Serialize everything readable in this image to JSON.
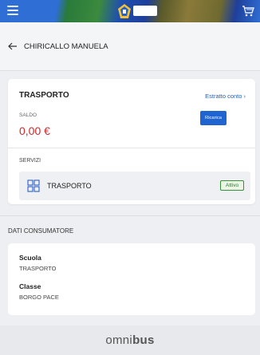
{
  "topbar": {
    "menu_icon": "hamburger-menu-icon",
    "logo_icon": "coat-of-arms-icon",
    "cart_icon": "cart-icon"
  },
  "header": {
    "back_icon": "arrow-left-icon",
    "name": "CHIRICALLO MANUELA"
  },
  "account_card": {
    "title": "TRASPORTO",
    "statement_link": "Estratto conto ›",
    "balance_label": "SALDO",
    "balance_value": "0,00 €",
    "recharge_button": "Ricarica",
    "services_label": "SERVIZI",
    "service": {
      "icon": "grid-icon",
      "name": "TRASPORTO",
      "status": "Attivo"
    }
  },
  "consumer": {
    "section_label": "DATI CONSUMATORE",
    "fields": [
      {
        "label": "Scuola",
        "value": "TRASPORTO"
      },
      {
        "label": "Classe",
        "value": "BORGO PACE"
      }
    ]
  },
  "footer": {
    "brand_light": "omni",
    "brand_bold": "bus"
  },
  "colors": {
    "accent_blue": "#1f64d1",
    "balance_red": "#d1262b",
    "active_green": "#3a8f3a"
  }
}
